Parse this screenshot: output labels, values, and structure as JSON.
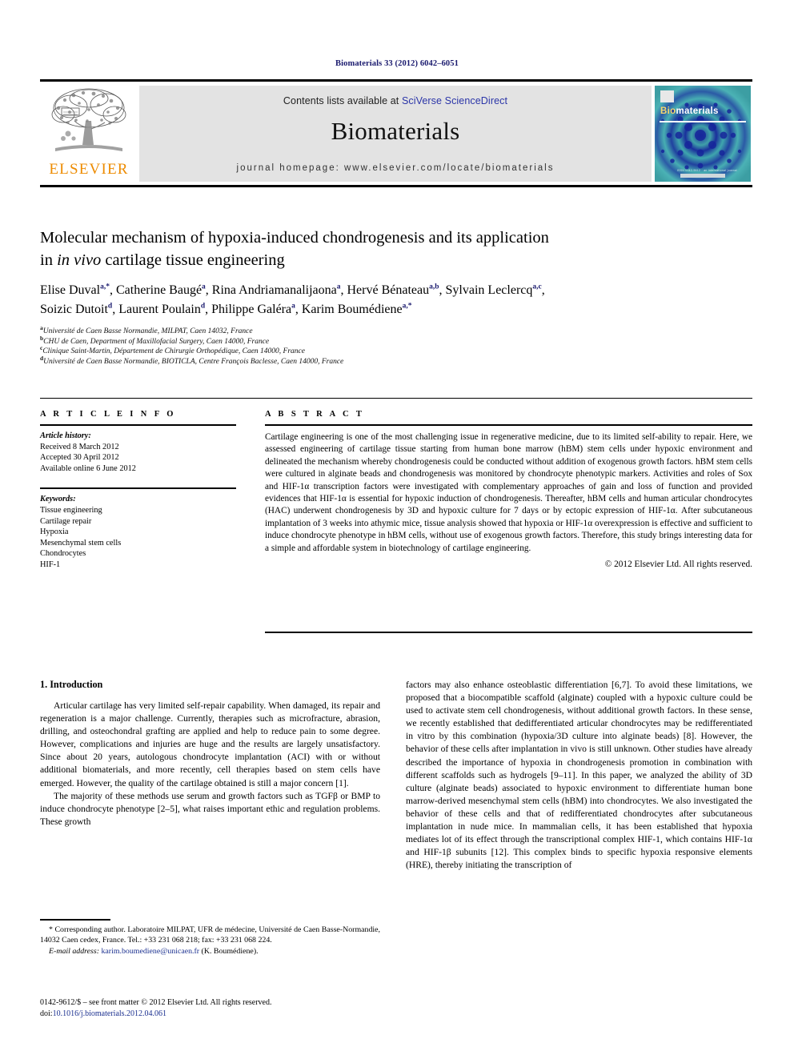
{
  "running_head": "Biomaterials 33 (2012) 6042–6051",
  "masthead": {
    "publisher_name": "ELSEVIER",
    "publisher_logo_icon": "elsevier-tree-icon",
    "contents_prefix": "Contents lists available at ",
    "contents_link": "SciVerse ScienceDirect",
    "journal_name": "Biomaterials",
    "homepage_label": "journal homepage: www.elsevier.com/locate/biomaterials",
    "cover": {
      "title_bio": "Bio",
      "title_rest": "materials",
      "footer_text": "ISSN 0142-9612 · an international journal",
      "background_color": "#2f9a9b",
      "accent_color": "#f5d76e"
    }
  },
  "article": {
    "title_line1": "Molecular mechanism of hypoxia-induced chondrogenesis and its application",
    "title_line2_pre": "in ",
    "title_line2_italic": "in vivo",
    "title_line2_post": " cartilage tissue engineering",
    "authors": [
      {
        "name": "Elise Duval",
        "sup": "a,*"
      },
      {
        "name": "Catherine Baugé",
        "sup": "a"
      },
      {
        "name": "Rina Andriamanalijaona",
        "sup": "a"
      },
      {
        "name": "Hervé Bénateau",
        "sup": "a,b"
      },
      {
        "name": "Sylvain Leclercq",
        "sup": "a,c"
      },
      {
        "name": "Soizic Dutoit",
        "sup": "d"
      },
      {
        "name": "Laurent Poulain",
        "sup": "d"
      },
      {
        "name": "Philippe Galéra",
        "sup": "a"
      },
      {
        "name": "Karim Boumédiene",
        "sup": "a,*"
      }
    ],
    "affiliations": [
      {
        "mark": "a",
        "text": "Université de Caen Basse Normandie, MILPAT, Caen 14032, France"
      },
      {
        "mark": "b",
        "text": "CHU de Caen, Department of Maxillofacial Surgery, Caen 14000, France"
      },
      {
        "mark": "c",
        "text": "Clinique Saint-Martin, Département de Chirurgie Orthopédique, Caen 14000, France"
      },
      {
        "mark": "d",
        "text": "Université de Caen Basse Normandie, BIOTICLA, Centre François Baclesse, Caen 14000, France"
      }
    ]
  },
  "article_info": {
    "heading": "A R T I C L E  I N F O",
    "history_label": "Article history:",
    "history": [
      "Received 8 March 2012",
      "Accepted 30 April 2012",
      "Available online 6 June 2012"
    ],
    "keywords_label": "Keywords:",
    "keywords": [
      "Tissue engineering",
      "Cartilage repair",
      "Hypoxia",
      "Mesenchymal stem cells",
      "Chondrocytes",
      "HIF-1"
    ]
  },
  "abstract": {
    "heading": "A B S T R A C T",
    "text": "Cartilage engineering is one of the most challenging issue in regenerative medicine, due to its limited self-ability to repair. Here, we assessed engineering of cartilage tissue starting from human bone marrow (hBM) stem cells under hypoxic environment and delineated the mechanism whereby chondrogenesis could be conducted without addition of exogenous growth factors. hBM stem cells were cultured in alginate beads and chondrogenesis was monitored by chondrocyte phenotypic markers. Activities and roles of Sox and HIF-1α transcription factors were investigated with complementary approaches of gain and loss of function and provided evidences that HIF-1α is essential for hypoxic induction of chondrogenesis. Thereafter, hBM cells and human articular chondrocytes (HAC) underwent chondrogenesis by 3D and hypoxic culture for 7 days or by ectopic expression of HIF-1α. After subcutaneous implantation of 3 weeks into athymic mice, tissue analysis showed that hypoxia or HIF-1α overexpression is effective and sufficient to induce chondrocyte phenotype in hBM cells, without use of exogenous growth factors. Therefore, this study brings interesting data for a simple and affordable system in biotechnology of cartilage engineering.",
    "copyright": "© 2012 Elsevier Ltd. All rights reserved."
  },
  "introduction": {
    "heading": "1. Introduction",
    "left_par1": "Articular cartilage has very limited self-repair capability. When damaged, its repair and regeneration is a major challenge. Currently, therapies such as microfracture, abrasion, drilling, and osteochondral grafting are applied and help to reduce pain to some degree. However, complications and injuries are huge and the results are largely unsatisfactory. Since about 20 years, autologous chondrocyte implantation (ACI) with or without additional biomaterials, and more recently, cell therapies based on stem cells have emerged. However, the quality of the cartilage obtained is still a major concern [1].",
    "left_par2": "The majority of these methods use serum and growth factors such as TGFβ or BMP to induce chondrocyte phenotype [2–5], what raises important ethic and regulation problems. These growth",
    "right_par1": "factors may also enhance osteoblastic differentiation [6,7]. To avoid these limitations, we proposed that a biocompatible scaffold (alginate) coupled with a hypoxic culture could be used to activate stem cell chondrogenesis, without additional growth factors. In these sense, we recently established that dedifferentiated articular chondrocytes may be redifferentiated in vitro by this combination (hypoxia/3D culture into alginate beads) [8]. However, the behavior of these cells after implantation in vivo is still unknown. Other studies have already described the importance of hypoxia in chondrogenesis promotion in combination with different scaffolds such as hydrogels [9–11]. In this paper, we analyzed the ability of 3D culture (alginate beads) associated to hypoxic environment to differentiate human bone marrow-derived mesenchymal stem cells (hBM) into chondrocytes. We also investigated the behavior of these cells and that of redifferentiated chondrocytes after subcutaneous implantation in nude mice. In mammalian cells, it has been established that hypoxia mediates lot of its effect through the transcriptional complex HIF-1, which contains HIF-1α and HIF-1β subunits [12]. This complex binds to specific hypoxia responsive elements (HRE), thereby initiating the transcription of"
  },
  "footnotes": {
    "corresponding": "* Corresponding author. Laboratoire MILPAT, UFR de médecine, Université de Caen Basse-Normandie, 14032 Caen cedex, France. Tel.: +33 231 068 218; fax: +33 231 068 224.",
    "email_label": "E-mail address:",
    "email": "karim.boumediene@unicaen.fr",
    "email_suffix": "(K. Boumédiene)."
  },
  "imprint": {
    "line1": "0142-9612/$ – see front matter © 2012 Elsevier Ltd. All rights reserved.",
    "doi_label": "doi:",
    "doi": "10.1016/j.biomaterials.2012.04.061"
  }
}
